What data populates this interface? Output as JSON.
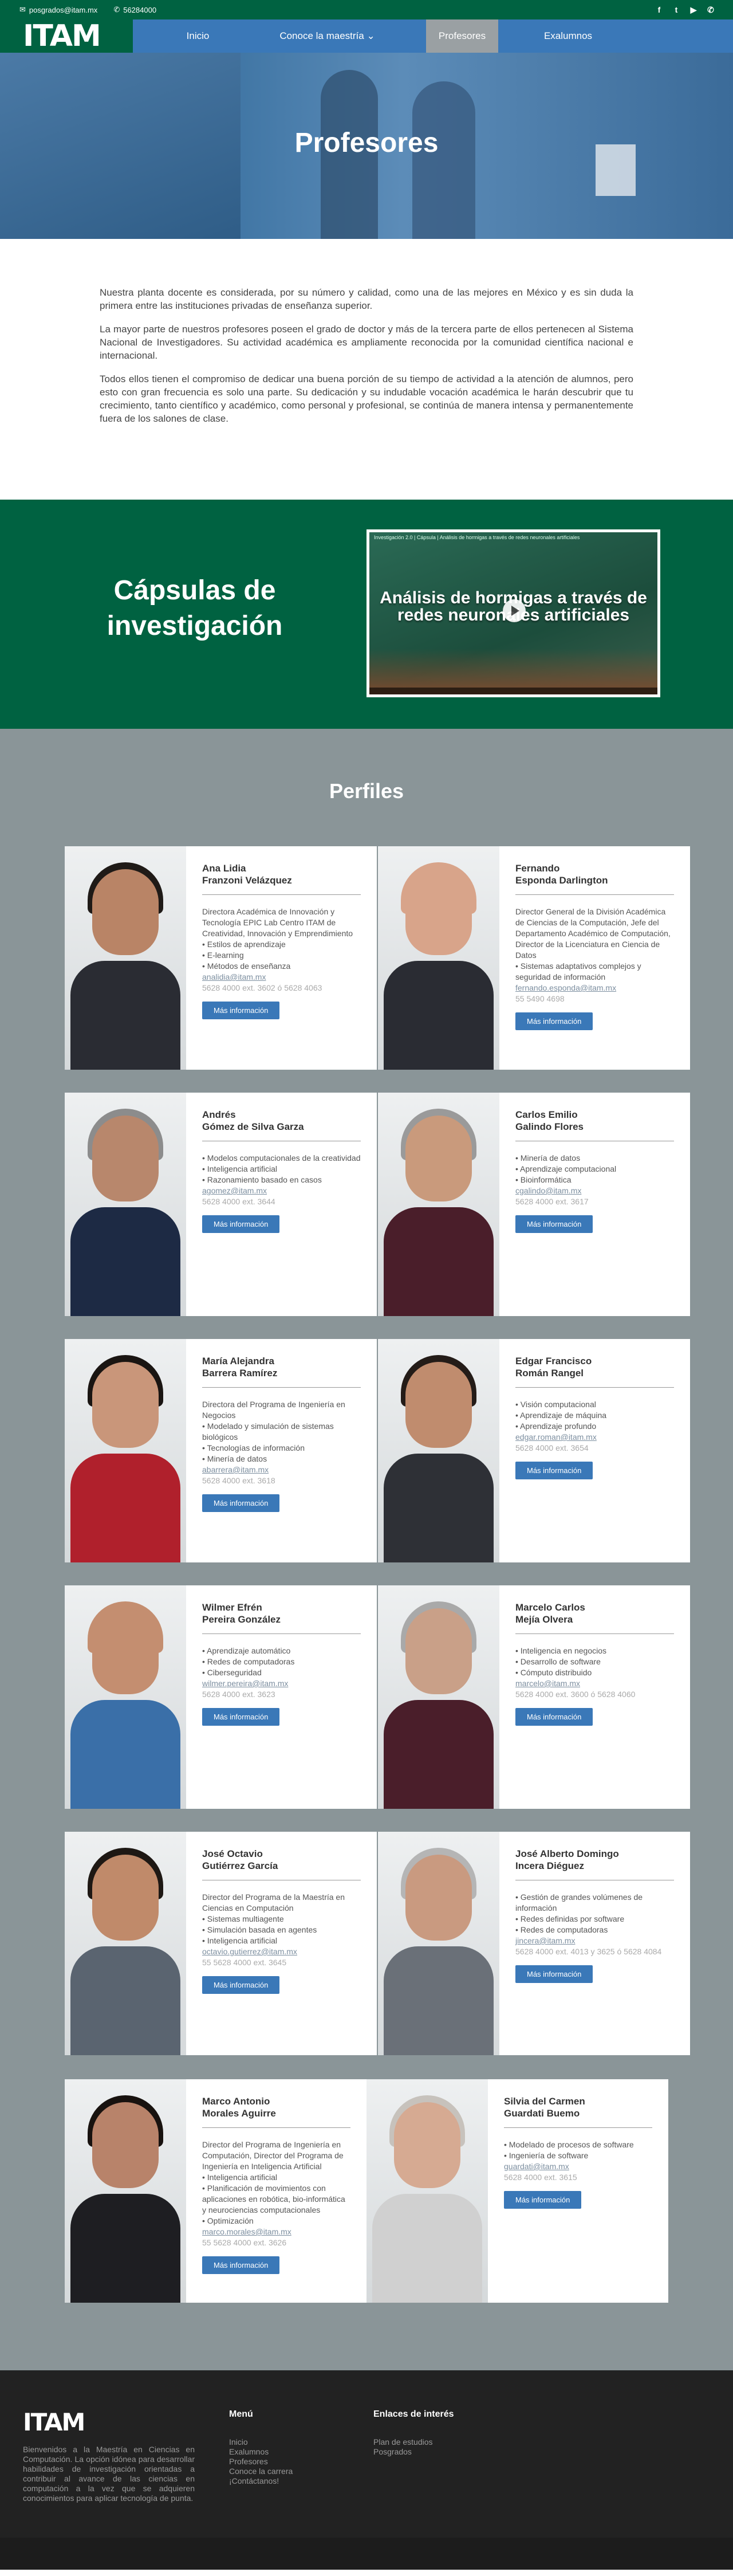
{
  "topbar": {
    "email": "posgrados@itam.mx",
    "phone": "56284000",
    "email_icon": "envelope-icon",
    "phone_icon": "phone-icon",
    "social": [
      {
        "name": "facebook-icon",
        "glyph": "f"
      },
      {
        "name": "twitter-icon",
        "glyph": "t"
      },
      {
        "name": "youtube-icon",
        "glyph": "▶"
      },
      {
        "name": "whatsapp-icon",
        "glyph": "✆"
      }
    ]
  },
  "brand": {
    "logo": "ITAM",
    "green": "#006241",
    "blue": "#3a78b8",
    "gray": "#8a9598"
  },
  "nav": [
    {
      "label": "Inicio"
    },
    {
      "label": "Conoce la maestría  ⌄"
    },
    {
      "label": "Profesores",
      "active": true
    },
    {
      "label": "Exalumnos"
    }
  ],
  "hero": {
    "title": "Profesores"
  },
  "intro": {
    "p1": "Nuestra planta docente es considerada, por su número y calidad, como una de las mejores en México y es sin duda la primera entre las instituciones privadas de enseñanza superior.",
    "p2": "La mayor parte de nuestros profesores poseen el grado de doctor y más de la tercera parte de ellos pertenecen al Sistema Nacional de Investigadores. Su actividad académica es ampliamente reconocida por la comunidad científica nacional e internacional.",
    "p3": "Todos ellos tienen el compromiso de dedicar una buena porción de su tiempo de actividad a la atención de alumnos, pero esto con gran frecuencia es solo una parte. Su dedicación y su indudable vocación académica le harán descubrir que tu crecimiento, tanto científico y académico, como personal y profesional, se continúa de manera intensa y permanentemente fuera de los salones de clase."
  },
  "capsulas": {
    "title": "Cápsulas de investigación",
    "video_title": "Investigación 2.0 | Cápsula | Análisis de hormigas a través de redes neuronales artificiales",
    "video_text": "Análisis de hormigas a través de redes neuronales artificiales"
  },
  "perfiles": {
    "title": "Perfiles",
    "button_label": "Más información",
    "people": [
      {
        "name1": "Ana Lidia",
        "name2": "Franzoni Velázquez",
        "lines": [
          {
            "t": "Directora Académica de Innovación y Tecnología EPIC Lab Centro ITAM de Creatividad, Innovación y Emprendimiento"
          },
          {
            "t": "Estilos de aprendizaje",
            "b": true
          },
          {
            "t": "E-learning",
            "b": true
          },
          {
            "t": "Métodos de enseñanza",
            "b": true
          }
        ],
        "email": "analidia@itam.mx",
        "tel": "5628 4000 ext. 3602 ó 5628 4063",
        "photo": {
          "skin": "#b98466",
          "hair": "#1f1a17",
          "suit": "#2a2c33"
        }
      },
      {
        "name1": "Fernando",
        "name2": "Esponda Darlington",
        "lines": [
          {
            "t": "Director General de la División Académica de Ciencias de la Computación, Jefe del Departamento Académico de Computación, Director de la Licenciatura en Ciencia de Datos"
          },
          {
            "t": "Sistemas adaptativos complejos y seguridad de información",
            "b": true
          }
        ],
        "email": "fernando.esponda@itam.mx",
        "tel": "55 5490 4698",
        "photo": {
          "skin": "#d8a48a",
          "hair": "#d8a48a",
          "suit": "#2a2c33"
        }
      },
      {
        "name1": "Andrés",
        "name2": "Gómez de Silva Garza",
        "lines": [
          {
            "t": "Modelos computacionales de la creatividad",
            "b": true
          },
          {
            "t": "Inteligencia artificial",
            "b": true
          },
          {
            "t": "Razonamiento basado en casos",
            "b": true
          }
        ],
        "email": "agomez@itam.mx",
        "tel": "5628 4000 ext. 3644",
        "photo": {
          "skin": "#b8876c",
          "hair": "#8c8c8c",
          "suit": "#1d2a44"
        }
      },
      {
        "name1": "Carlos Emilio",
        "name2": "Galindo Flores",
        "lines": [
          {
            "t": "Minería de datos",
            "b": true
          },
          {
            "t": "Aprendizaje computacional",
            "b": true
          },
          {
            "t": "Bioinformática",
            "b": true
          }
        ],
        "email": "cgalindo@itam.mx",
        "tel": "5628 4000 ext. 3617",
        "photo": {
          "skin": "#c99a7c",
          "hair": "#9a9a9a",
          "suit": "#4a1e2a"
        }
      },
      {
        "name1": "María Alejandra",
        "name2": "Barrera Ramírez",
        "lines": [
          {
            "t": "Directora del Programa de Ingeniería en Negocios"
          },
          {
            "t": "Modelado y simulación de sistemas biológicos",
            "b": true
          },
          {
            "t": "Tecnologías de información",
            "b": true
          },
          {
            "t": "Minería de datos",
            "b": true
          }
        ],
        "email": "abarrera@itam.mx",
        "tel": "5628 4000 ext. 3618",
        "photo": {
          "skin": "#c9967a",
          "hair": "#1a1512",
          "suit": "#b0202c"
        }
      },
      {
        "name1": "Edgar Francisco",
        "name2": "Román Rangel",
        "lines": [
          {
            "t": "Visión computacional",
            "b": true
          },
          {
            "t": "Aprendizaje de máquina",
            "b": true
          },
          {
            "t": "Aprendizaje profundo",
            "b": true
          }
        ],
        "email": "edgar.roman@itam.mx",
        "tel": "5628 4000 ext. 3654",
        "photo": {
          "skin": "#c08c6e",
          "hair": "#241c18",
          "suit": "#2e3036"
        }
      },
      {
        "name1": "Wilmer Efrén",
        "name2": "Pereira González",
        "lines": [
          {
            "t": "Aprendizaje automático",
            "b": true
          },
          {
            "t": "Redes de computadoras",
            "b": true
          },
          {
            "t": "Ciberseguridad",
            "b": true
          }
        ],
        "email": "wilmer.pereira@itam.mx",
        "tel": "5628 4000 ext. 3623",
        "photo": {
          "skin": "#c48e70",
          "hair": "#c48e70",
          "suit": "#3a6fa8"
        }
      },
      {
        "name1": "Marcelo Carlos",
        "name2": "Mejía Olvera",
        "lines": [
          {
            "t": "Inteligencia en negocios",
            "b": true
          },
          {
            "t": "Desarrollo de software",
            "b": true
          },
          {
            "t": "Cómputo distribuido",
            "b": true
          }
        ],
        "email": "marcelo@itam.mx",
        "tel": "5628 4000 ext. 3600 ó 5628 4060",
        "photo": {
          "skin": "#c9a088",
          "hair": "#a9a9a9",
          "suit": "#4a1e2a"
        }
      },
      {
        "name1": "José Octavio",
        "name2": "Gutiérrez García",
        "lines": [
          {
            "t": "Director del Programa de la Maestría en Ciencias en Computación"
          },
          {
            "t": "Sistemas multiagente",
            "b": true
          },
          {
            "t": "Simulación basada en agentes",
            "b": true
          },
          {
            "t": "Inteligencia artificial",
            "b": true
          }
        ],
        "email": "octavio.gutierrez@itam.mx",
        "tel": "55 5628 4000 ext. 3645",
        "photo": {
          "skin": "#c08a6a",
          "hair": "#1e1814",
          "suit": "#5a6470"
        }
      },
      {
        "name1": "José Alberto Domingo",
        "name2": "Incera Diéguez",
        "lines": [
          {
            "t": "Gestión de grandes volúmenes de información",
            "b": true
          },
          {
            "t": "Redes definidas por software",
            "b": true
          },
          {
            "t": "Redes de computadoras",
            "b": true
          }
        ],
        "email": "jincera@itam.mx",
        "tel": "5628 4000 ext. 4013 y 3625 ó 5628 4084",
        "photo": {
          "skin": "#c99a80",
          "hair": "#b5b5b5",
          "suit": "#6a7078"
        }
      },
      {
        "name1": "Marco Antonio",
        "name2": "Morales Aguirre",
        "lines": [
          {
            "t": "Director del Programa de Ingeniería en Computación, Director del Programa de Ingeniería en Inteligencia Artificial"
          },
          {
            "t": "Inteligencia artificial",
            "b": true
          },
          {
            "t": "Planificación de movimientos con aplicaciones en robótica, bio-informática y neurociencias computacionales",
            "b": true
          },
          {
            "t": "Optimización",
            "b": true
          }
        ],
        "email": "marco.morales@itam.mx",
        "tel": "55 5628 4000 ext. 3626",
        "photo": {
          "skin": "#b8836a",
          "hair": "#18120f",
          "suit": "#1e1e22"
        }
      },
      {
        "name1": "Silvia del Carmen",
        "name2": "Guardati Buemo",
        "lines": [
          {
            "t": "Modelado de procesos de software",
            "b": true
          },
          {
            "t": "Ingeniería de software",
            "b": true
          }
        ],
        "email": "guardati@itam.mx",
        "tel": "5628 4000 ext. 3615",
        "photo": {
          "skin": "#d6aa92",
          "hair": "#c7c2bc",
          "suit": "#d0d0d0"
        }
      }
    ]
  },
  "footer": {
    "logo": "ITAM",
    "description": "Bienvenidos a la Maestría en Ciencias en Computación. La opción idónea para desarrollar habilidades de investigación orientadas a contribuir al avance de las ciencias en computación a la vez que se adquieren conocimientos para aplicar tecnología de punta.",
    "menu_title": "Menú",
    "menu": [
      "Inicio",
      "Exalumnos",
      "Profesores",
      "Conoce la carrera",
      "¡Contáctanos!"
    ],
    "links_title": "Enlaces de interés",
    "links": [
      "Plan de estudios",
      "Posgrados"
    ]
  }
}
